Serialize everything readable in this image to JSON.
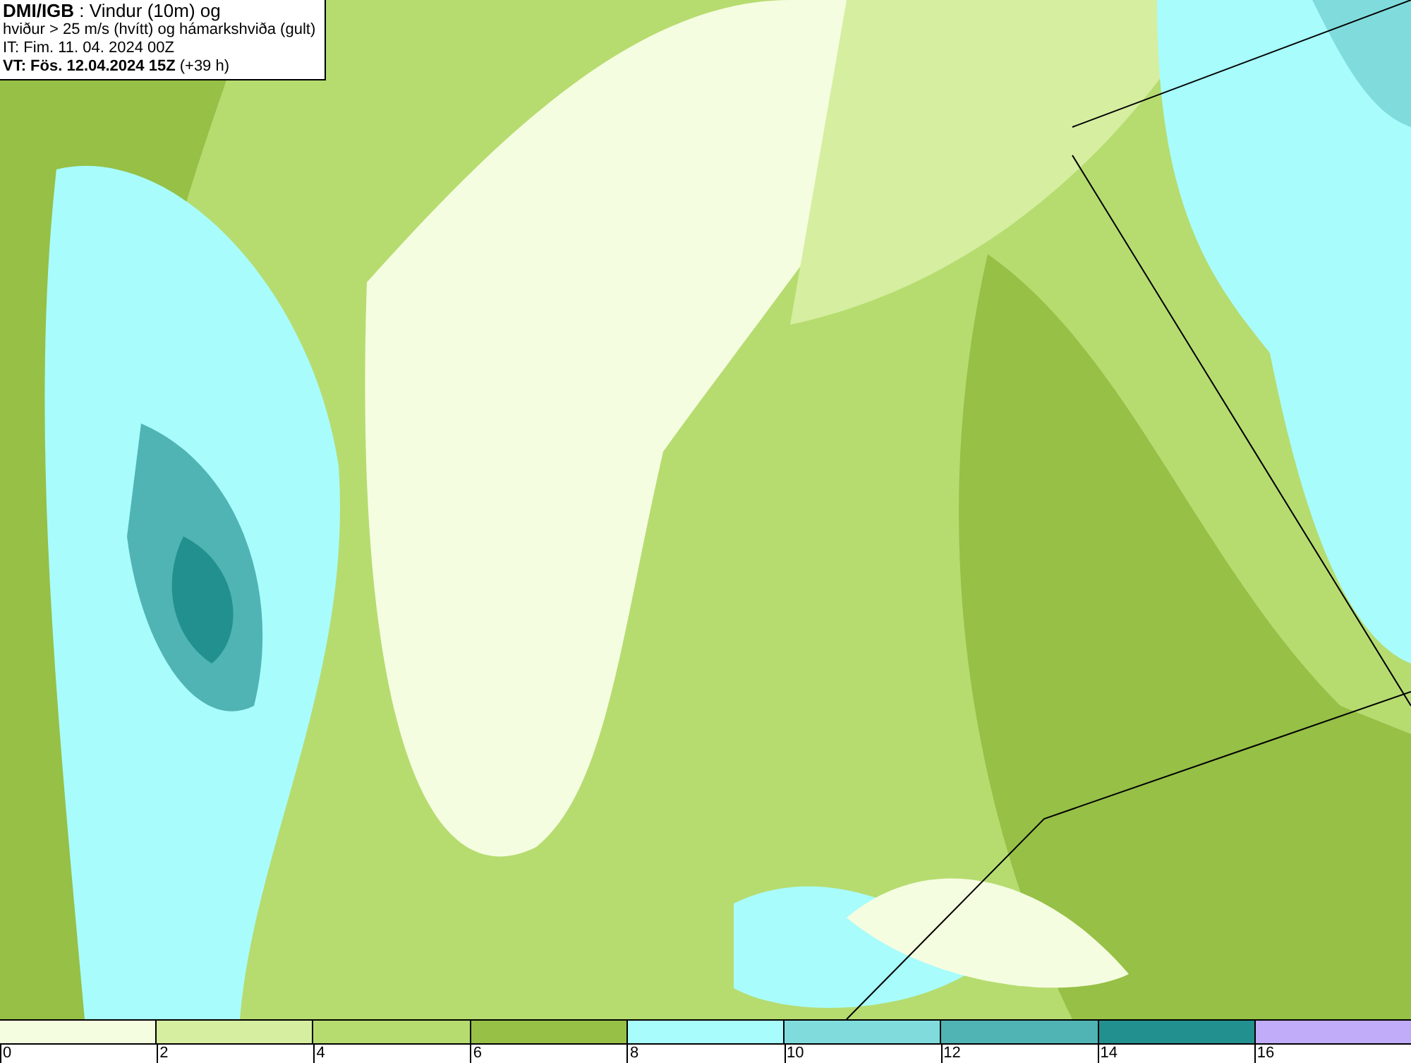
{
  "header": {
    "lines": [
      "**DMI/IGB** : Vindur (10m) og",
      "hviður > 25 m/s (hvítt) og hámarkshviða (gult)",
      "IT: Fim. 11. 04. 2024 00Z",
      "**VT: Fös. 12.04.2024 15Z** (+39 h)"
    ]
  },
  "legend": [
    {
      "label": "0",
      "color": "#f5fde0"
    },
    {
      "label": "2",
      "color": "#d6eea0"
    },
    {
      "label": "4",
      "color": "#b6dc70"
    },
    {
      "label": "6",
      "color": "#96c046"
    },
    {
      "label": "8",
      "color": "#a8fcfc"
    },
    {
      "label": "10",
      "color": "#80dcdc"
    },
    {
      "label": "12",
      "color": "#50b4b4"
    },
    {
      "label": "14",
      "color": "#239090"
    },
    {
      "label": "16",
      "color": "#c0acf8"
    }
  ]
}
